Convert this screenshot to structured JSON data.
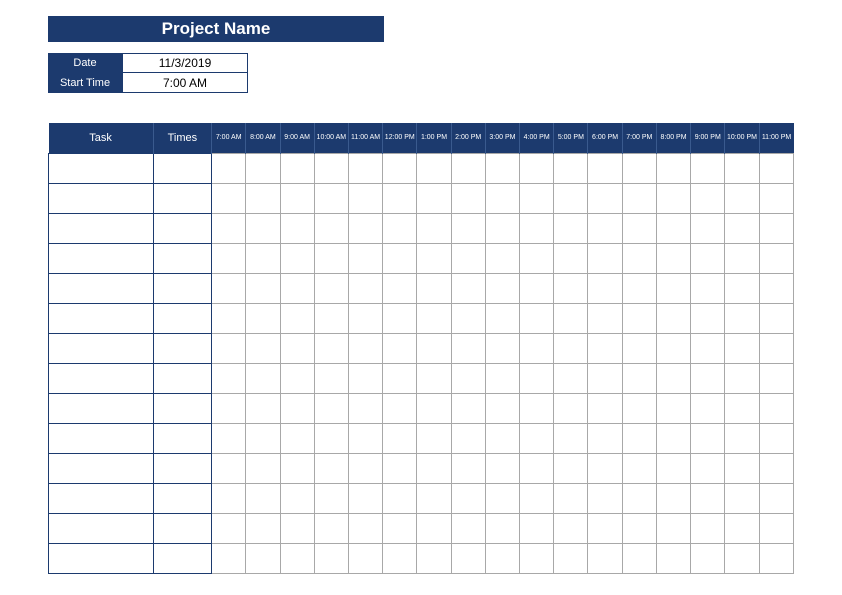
{
  "title": "Project Name",
  "meta": {
    "date_label": "Date",
    "date_value": "11/3/2019",
    "start_time_label": "Start Time",
    "start_time_value": "7:00 AM"
  },
  "table": {
    "task_header": "Task",
    "times_header": "Times",
    "hours": [
      "7:00 AM",
      "8:00 AM",
      "9:00 AM",
      "10:00 AM",
      "11:00 AM",
      "12:00 PM",
      "1:00 PM",
      "2:00 PM",
      "3:00 PM",
      "4:00 PM",
      "5:00 PM",
      "6:00 PM",
      "7:00 PM",
      "8:00 PM",
      "9:00 PM",
      "10:00 PM",
      "11:00 PM"
    ],
    "rows": 14
  }
}
